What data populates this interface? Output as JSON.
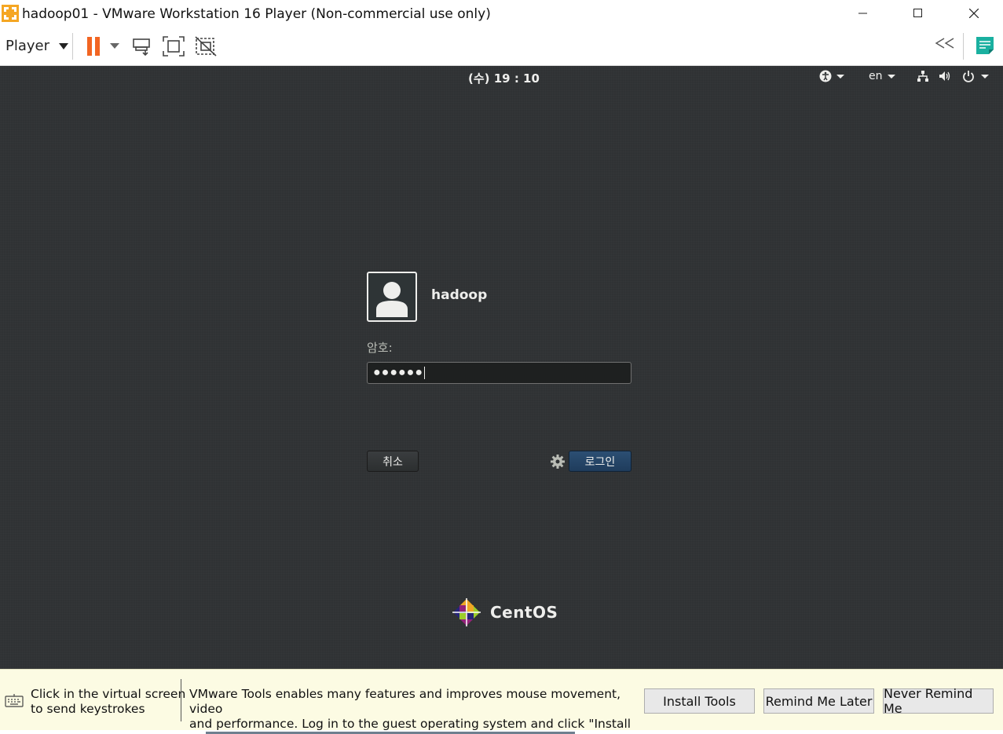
{
  "window": {
    "title": "hadoop01 - VMware Workstation 16 Player (Non-commercial use only)",
    "controls": {
      "minimize": "minimize-icon",
      "maximize": "maximize-icon",
      "close": "close-icon"
    }
  },
  "toolbar": {
    "player_menu": "Player",
    "icons": [
      "pause-icon",
      "dropdown-caret-icon",
      "send-ctrl-alt-del-icon",
      "fullscreen-icon",
      "unity-icon",
      "collapse-icon",
      "notes-icon"
    ],
    "pause_color": "#f26522",
    "notes_color": "#1ab0a0"
  },
  "vm": {
    "topbar": {
      "clock": "(수) 19 : 10",
      "language": "en",
      "icons": [
        "accessibility-icon",
        "network-icon",
        "volume-icon",
        "power-icon"
      ]
    },
    "login": {
      "username": "hadoop",
      "password_label": "암호:",
      "password_value": "●●●●●●",
      "cancel_label": "취소",
      "login_label": "로그인"
    },
    "distro_logo": "CentOS",
    "background_color": "#2f3234",
    "accent_color": "#24466b"
  },
  "notification": {
    "hint_line1": "Click in the virtual screen",
    "hint_line2": "to send keystrokes",
    "message_line1": "VMware Tools enables many features and improves mouse movement, video",
    "message_line2": "and performance. Log in to the guest operating system and click \"Install Tools\".",
    "install_label": "Install Tools",
    "remind_label": "Remind Me Later",
    "never_label": "Never Remind Me",
    "background_color": "#fcfbe3"
  }
}
